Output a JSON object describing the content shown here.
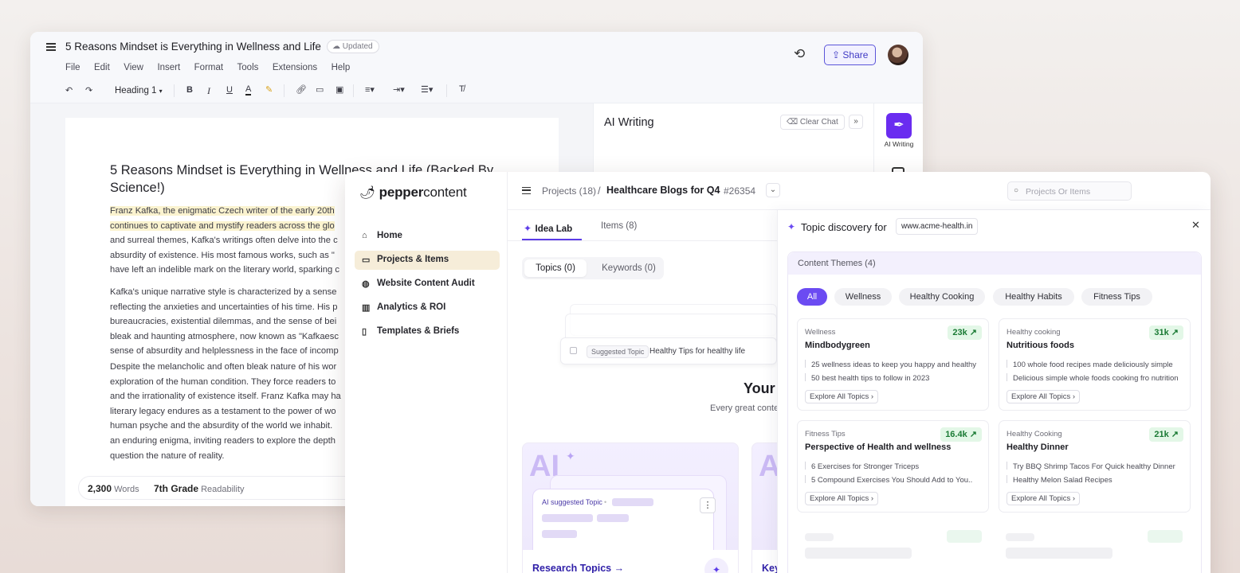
{
  "doc": {
    "title": "5 Reasons Mindset is Everything in Wellness and Life",
    "status_badge": "Updated",
    "menus": [
      "File",
      "Edit",
      "View",
      "Insert",
      "Format",
      "Tools",
      "Extensions",
      "Help"
    ],
    "share_label": "Share",
    "heading_style": "Heading 1",
    "heading": [
      "5 Reasons Mindset is Everything in Wellness and Life (Backed By",
      "Science!)"
    ],
    "para1": [
      "Franz Kafka, the enigmatic Czech writer of the early 20th",
      "continues to captivate and mystify readers across the glo",
      "and surreal themes, Kafka's writings often delve into the c",
      "absurdity of existence. His most famous works, such as \"",
      "have left an indelible mark on the literary world, sparking c"
    ],
    "para2": [
      "Kafka's unique narrative style is characterized by a sense",
      "reflecting the anxieties and uncertainties of his time. His p",
      "bureaucracies, existential dilemmas, and the sense of bei",
      "bleak and haunting atmosphere, now known as \"Kafkaesc",
      "sense of absurdity and helplessness in the face of incomp"
    ],
    "para3": [
      "Despite the melancholic and often bleak nature of his wor",
      "exploration of the human condition. They force readers to",
      "and the irrationality of existence itself. Franz Kafka may ha",
      "literary legacy endures as a testament to the power of wo",
      "human psyche and the absurdity of the world we inhabit.",
      "an enduring enigma, inviting readers to explore the depth",
      "question the nature of reality."
    ],
    "word_count": "2,300",
    "word_label": "Words",
    "grade": "7th Grade",
    "readability_label": "Readability",
    "ai_panel_title": "AI Writing",
    "clear_chat": "Clear Chat",
    "ai_rail_label": "AI Writing"
  },
  "pepper": {
    "logo_bold": "pepper",
    "logo_light": "content",
    "nav": [
      "Home",
      "Projects & Items",
      "Website Content Audit",
      "Analytics & ROI",
      "Templates & Briefs"
    ],
    "crumb_projects": "Projects (18)",
    "crumb_sep": "/",
    "crumb_current": "Healthcare Blogs for Q4",
    "crumb_id": "#26354",
    "search_placeholder": "Projects Or Items",
    "tabs": [
      "Idea Lab",
      "Items (8)"
    ],
    "segments": [
      "Topics (0)",
      "Keywords (0)"
    ],
    "suggested_chip": "Suggested Topic",
    "suggested_text": "Healthy Tips for healthy life",
    "empty_title": "Your",
    "empty_sub": "Every great conte",
    "ai_badge": "AI",
    "ai_suggested_label": "AI suggested Topic",
    "card1_title": "Research Topics →",
    "card2_title": "Key",
    "topic_discovery": {
      "title": "Topic discovery for",
      "url": "www.acme-health.in",
      "themes_header": "Content Themes (4)",
      "filters": [
        "All",
        "Wellness",
        "Healthy Cooking",
        "Healthy Habits",
        "Fitness Tips"
      ],
      "explore_label": "Explore All Topics",
      "cards": [
        {
          "category": "Wellness",
          "name": "Mindbodygreen",
          "count": "23k",
          "lines": [
            "25 wellness ideas to keep you happy and healthy",
            "50 best health tips to follow in 2023"
          ]
        },
        {
          "category": "Healthy cooking",
          "name": "Nutritious foods",
          "count": "31k",
          "lines": [
            "100 whole food recipes made deliciously simple",
            "Delicious simple whole foods cooking fro nutrition"
          ]
        },
        {
          "category": "Fitness Tips",
          "name": "Perspective of Health and wellness",
          "count": "16.4k",
          "lines": [
            "6 Exercises for Stronger Triceps",
            "5 Compound Exercises You Should Add to You.."
          ]
        },
        {
          "category": "Healthy Cooking",
          "name": "Healthy Dinner",
          "count": "21k",
          "lines": [
            "Try BBQ Shrimp Tacos For Quick healthy Dinner",
            "Healthy Melon Salad Recipes"
          ]
        }
      ]
    }
  },
  "colors": {
    "accent": "#6b4bf2",
    "ai_purple": "#6a2cf0",
    "trend_green": "#1a7a34",
    "highlight": "#fbf3cf"
  }
}
